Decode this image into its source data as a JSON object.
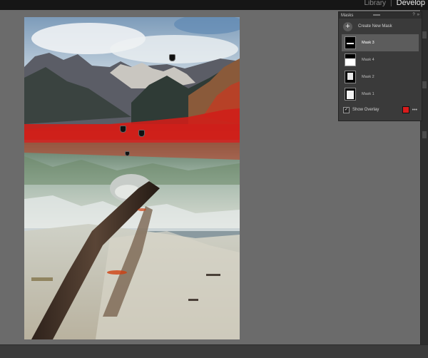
{
  "topbar": {
    "modules": [
      "Library",
      "Develop"
    ],
    "separator": "|"
  },
  "mask_panel": {
    "title": "Masks",
    "create_label": "Create New Mask",
    "masks": [
      {
        "name": "Mask 3",
        "selected": true
      },
      {
        "name": "Mask 4",
        "selected": false
      },
      {
        "name": "Mask 2",
        "selected": false
      },
      {
        "name": "Mask 1",
        "selected": false
      }
    ],
    "show_overlay_label": "Show Overlay",
    "show_overlay_checked": true,
    "overlay_color": "#d81c1c",
    "more_glyph": "•••",
    "plus_glyph": "+",
    "check_glyph": "✓"
  },
  "colors": {
    "background": "#6b6b6b",
    "panel": "#3a3a3a",
    "overlay_red": "#d81c1c"
  }
}
